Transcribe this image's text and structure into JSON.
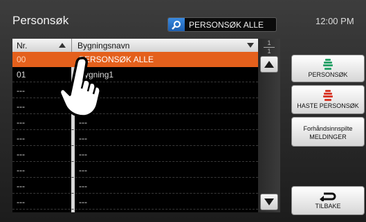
{
  "header": {
    "title": "Personsøk",
    "search_label": "PERSONSØK ALLE",
    "clock": "12:00 PM"
  },
  "table": {
    "col_nr": "Nr.",
    "col_name": "Bygningsnavn",
    "rows": [
      {
        "nr": "00",
        "name": "PERSONSØK ALLE"
      },
      {
        "nr": "01",
        "name": "Bygning1"
      },
      {
        "nr": "---",
        "name": "---"
      },
      {
        "nr": "---",
        "name": "---"
      },
      {
        "nr": "---",
        "name": "---"
      },
      {
        "nr": "---",
        "name": "---"
      },
      {
        "nr": "---",
        "name": "---"
      },
      {
        "nr": "---",
        "name": "---"
      },
      {
        "nr": "---",
        "name": "---"
      },
      {
        "nr": "---",
        "name": "---"
      }
    ]
  },
  "pager": {
    "current": "1",
    "total": "1"
  },
  "buttons": {
    "paging": "PERSONSØK",
    "urgent": "HASTE PERSONSØK",
    "preset_line1": "Forhåndsinnspilte",
    "preset_line2": "MELDINGER",
    "back": "TILBAKE"
  },
  "colors": {
    "selected_row": "#e4601c",
    "paging_icon": "#2aa36a",
    "urgent_icon": "#d93a2b"
  },
  "icons": [
    "search-icon",
    "sort-up-icon",
    "filter-down-icon",
    "scroll-up-icon",
    "scroll-down-icon",
    "speaker-icon",
    "back-arrow-icon",
    "hand-pointer-icon"
  ]
}
